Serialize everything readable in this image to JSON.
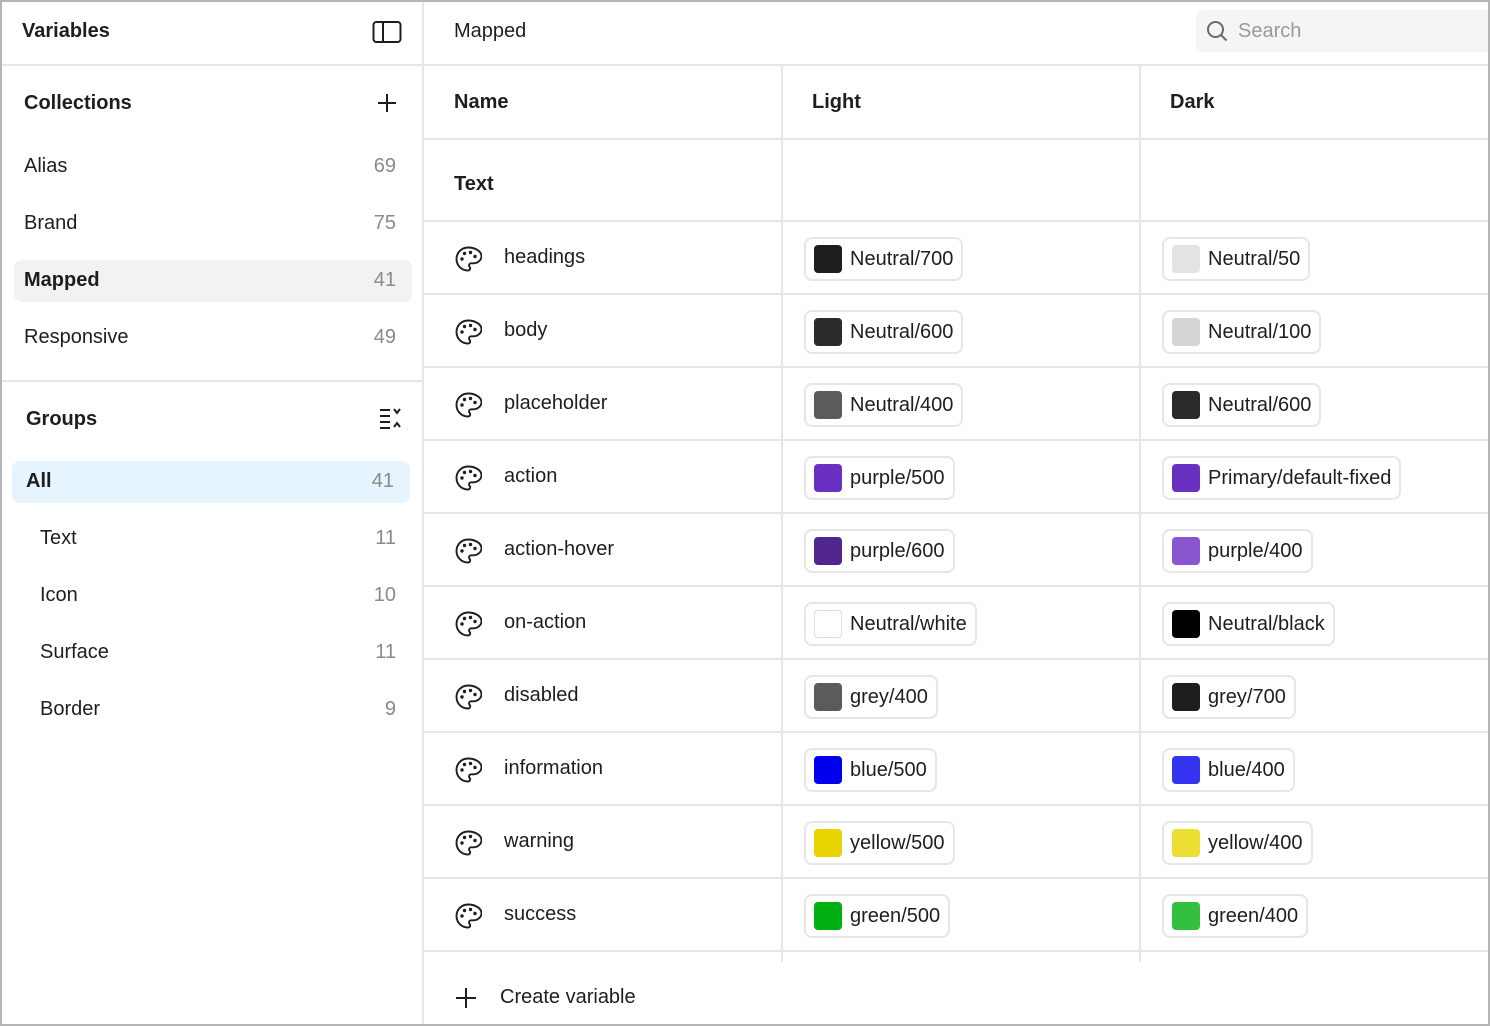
{
  "sidebar": {
    "title": "Variables",
    "panel_icon": "sidebar-panel-icon",
    "collections": {
      "title": "Collections",
      "add_icon": "plus-icon",
      "items": [
        {
          "label": "Alias",
          "count": "69"
        },
        {
          "label": "Brand",
          "count": "75"
        },
        {
          "label": "Mapped",
          "count": "41",
          "selected": true
        },
        {
          "label": "Responsive",
          "count": "49"
        }
      ]
    },
    "groups": {
      "title": "Groups",
      "sort_icon": "list-collapse-icon",
      "items": [
        {
          "label": "All",
          "count": "41",
          "selected": true
        },
        {
          "label": "Text",
          "count": "11"
        },
        {
          "label": "Icon",
          "count": "10"
        },
        {
          "label": "Surface",
          "count": "11"
        },
        {
          "label": "Border",
          "count": "9"
        }
      ]
    }
  },
  "main": {
    "title": "Mapped",
    "search": {
      "placeholder": "Search",
      "value": "",
      "icon": "search-icon"
    },
    "columns": [
      "Name",
      "Light",
      "Dark"
    ],
    "group_label": "Text",
    "rows": [
      {
        "name": "headings",
        "icon": "palette-icon",
        "light": {
          "label": "Neutral/700",
          "color": "#1e1e1e"
        },
        "dark": {
          "label": "Neutral/50",
          "color": "#e3e3e3"
        }
      },
      {
        "name": "body",
        "icon": "palette-icon",
        "light": {
          "label": "Neutral/600",
          "color": "#2a2a2a"
        },
        "dark": {
          "label": "Neutral/100",
          "color": "#d4d4d4"
        }
      },
      {
        "name": "placeholder",
        "icon": "palette-icon",
        "light": {
          "label": "Neutral/400",
          "color": "#5b5b5b"
        },
        "dark": {
          "label": "Neutral/600",
          "color": "#2a2a2a"
        }
      },
      {
        "name": "action",
        "icon": "palette-icon",
        "light": {
          "label": "purple/500",
          "color": "#6a30c2"
        },
        "dark": {
          "label": "Primary/default-fixed",
          "color": "#6a30c2"
        }
      },
      {
        "name": "action-hover",
        "icon": "palette-icon",
        "light": {
          "label": "purple/600",
          "color": "#51268f"
        },
        "dark": {
          "label": "purple/400",
          "color": "#8a56cf"
        }
      },
      {
        "name": "on-action",
        "icon": "palette-icon",
        "light": {
          "label": "Neutral/white",
          "color": "#ffffff"
        },
        "dark": {
          "label": "Neutral/black",
          "color": "#000000"
        }
      },
      {
        "name": "disabled",
        "icon": "palette-icon",
        "light": {
          "label": "grey/400",
          "color": "#5b5b5b"
        },
        "dark": {
          "label": "grey/700",
          "color": "#1e1e1e"
        }
      },
      {
        "name": "information",
        "icon": "palette-icon",
        "light": {
          "label": "blue/500",
          "color": "#0000ee"
        },
        "dark": {
          "label": "blue/400",
          "color": "#3333f0"
        }
      },
      {
        "name": "warning",
        "icon": "palette-icon",
        "light": {
          "label": "yellow/500",
          "color": "#e8d400"
        },
        "dark": {
          "label": "yellow/400",
          "color": "#ecdf33"
        }
      },
      {
        "name": "success",
        "icon": "palette-icon",
        "light": {
          "label": "green/500",
          "color": "#00b012"
        },
        "dark": {
          "label": "green/400",
          "color": "#33c03f"
        }
      }
    ],
    "create": {
      "label": "Create variable",
      "icon": "plus-icon"
    }
  },
  "colors": {
    "selected_collection_bg": "#f2f2f2",
    "selected_group_bg": "#e5f4ff",
    "border": "#e6e6e6"
  }
}
